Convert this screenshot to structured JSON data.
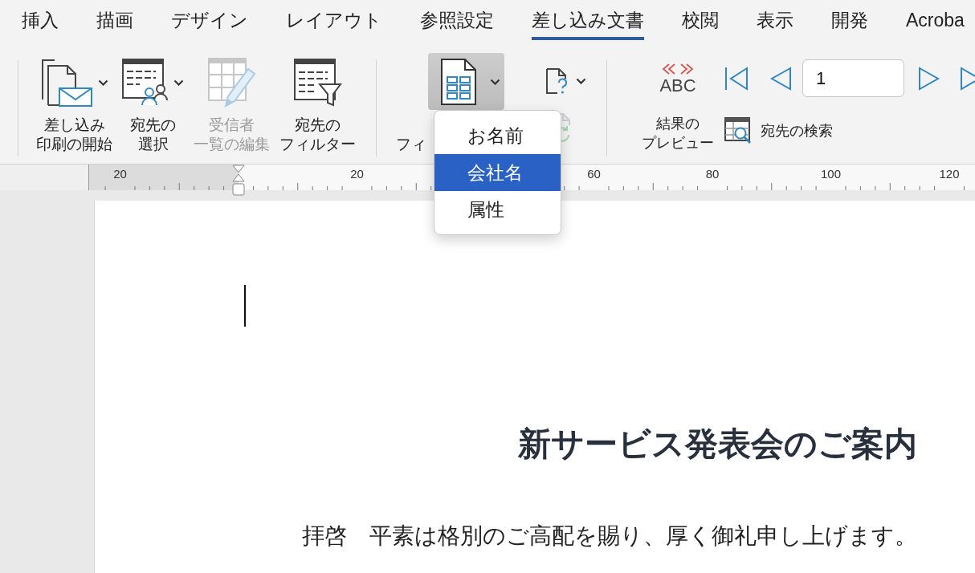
{
  "tabs": [
    {
      "label": "挿入",
      "selected": false
    },
    {
      "label": "描画",
      "selected": false
    },
    {
      "label": "デザイン",
      "selected": false
    },
    {
      "label": "レイアウト",
      "selected": false
    },
    {
      "label": "参照設定",
      "selected": false
    },
    {
      "label": "差し込み文書",
      "selected": true
    },
    {
      "label": "校閲",
      "selected": false
    },
    {
      "label": "表示",
      "selected": false
    },
    {
      "label": "開発",
      "selected": false
    },
    {
      "label": "Acroba",
      "selected": false
    }
  ],
  "ribbon": {
    "start_group": [
      {
        "label": [
          "差し込み",
          "印刷の開始"
        ],
        "menu": true,
        "disabled": false
      },
      {
        "label": [
          "宛先の",
          "選択"
        ],
        "menu": true,
        "disabled": false
      },
      {
        "label": [
          "受信者",
          "一覧の編集"
        ],
        "menu": false,
        "disabled": true
      },
      {
        "label": [
          "宛先の",
          "フィルター"
        ],
        "menu": false,
        "disabled": false
      }
    ],
    "field_group": {
      "field_button": {
        "label": "フィ",
        "pressed": true,
        "menu": true
      },
      "rules_button": {
        "menu": true
      },
      "update_button": {
        "disabled": true
      }
    },
    "preview_group": {
      "preview_button": {
        "icon_text": "ABC",
        "label": [
          "結果の",
          "プレビュー"
        ]
      },
      "record": {
        "value": "1"
      },
      "find_button": {
        "label": "宛先の検索"
      }
    }
  },
  "field_menu": {
    "items": [
      {
        "label": "お名前",
        "selected": false
      },
      {
        "label": "会社名",
        "selected": true
      },
      {
        "label": "属性",
        "selected": false
      }
    ]
  },
  "ruler": {
    "labels": [
      "20",
      "20",
      "60",
      "80",
      "100",
      "120"
    ]
  },
  "document": {
    "title": "新サービス発表会のご案内",
    "paragraph": "拝啓　平素は格別のご高配を賜り、厚く御礼申し上げます。"
  }
}
